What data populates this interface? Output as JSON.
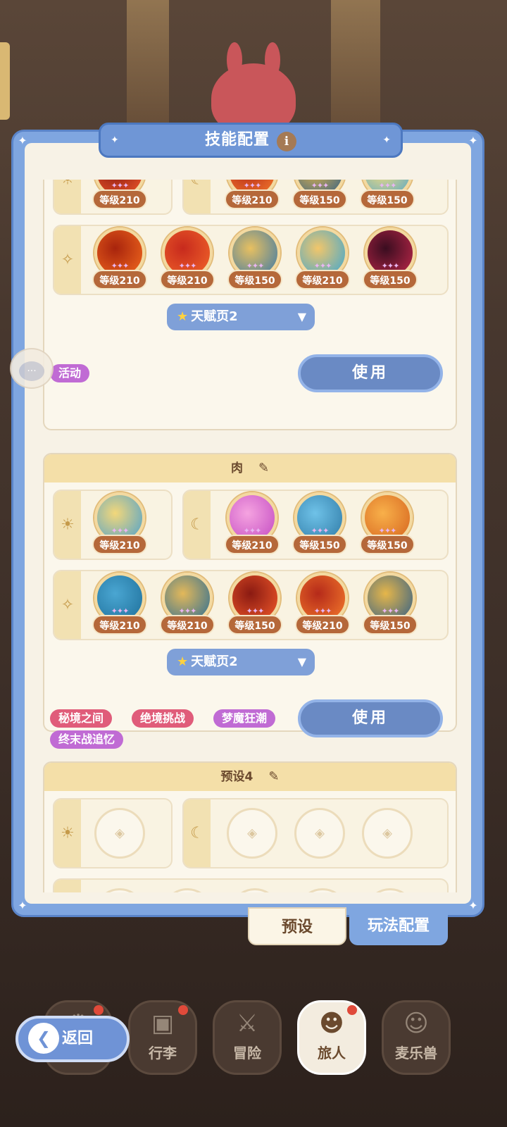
{
  "title": "技能配置",
  "info_label": "i",
  "chat_label": "···",
  "presets": [
    {
      "name": "",
      "sun_row": [
        {
          "level": "等级210"
        }
      ],
      "moon_row": [
        {
          "level": "等级210"
        },
        {
          "level": "等级150"
        },
        {
          "level": "等级150"
        }
      ],
      "star_row": [
        {
          "level": "等级210"
        },
        {
          "level": "等级210"
        },
        {
          "level": "等级150"
        },
        {
          "level": "等级210"
        },
        {
          "level": "等级150"
        }
      ],
      "talent": "天赋页2",
      "tags": [
        "活动"
      ],
      "use_label": "使用"
    },
    {
      "name": "肉",
      "sun_row": [
        {
          "level": "等级210"
        }
      ],
      "moon_row": [
        {
          "level": "等级210"
        },
        {
          "level": "等级150"
        },
        {
          "level": "等级150"
        }
      ],
      "star_row": [
        {
          "level": "等级210"
        },
        {
          "level": "等级210"
        },
        {
          "level": "等级150"
        },
        {
          "level": "等级210"
        },
        {
          "level": "等级150"
        }
      ],
      "talent": "天赋页2",
      "tags": [
        "秘境之间",
        "绝境挑战",
        "梦魔狂潮",
        "终末战追忆"
      ],
      "use_label": "使用"
    },
    {
      "name": "预设4"
    }
  ],
  "tabs": {
    "preset": "预设",
    "play_config": "玩法配置"
  },
  "back_label": "返回",
  "nav": [
    "行李",
    "冒险",
    "旅人",
    "麦乐兽"
  ],
  "icons": {
    "sun": "☀",
    "moon": "☾",
    "star": "✧",
    "edit": "✎",
    "talent_star": "★",
    "dropdown": "▼",
    "back": "❮",
    "stars": "✦✦✦"
  },
  "colors": {
    "panel": "#7fa6e0",
    "level_badge": "#b5683a",
    "use_button": "#6a8ac4",
    "tag_purple": "#c06bd4",
    "tag_red": "#e05c7a"
  }
}
